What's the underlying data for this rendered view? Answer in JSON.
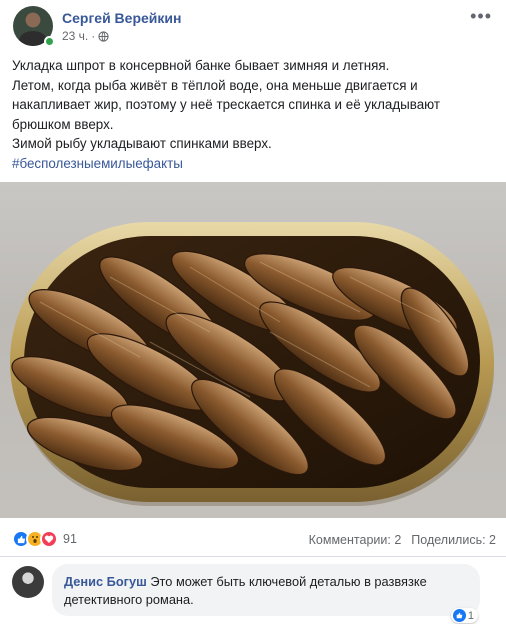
{
  "post": {
    "author": "Сергей Верейкин",
    "time": "23 ч.",
    "audience_icon": "globe-icon",
    "more_icon": "more-options-icon",
    "lines": [
      "Укладка шпрот в консервной банке бывает зимняя и летняя.",
      "Летом, когда рыба живёт в тёплой воде, она меньше двигается и",
      "накапливает жир, поэтому у неё трескается спинка и её укладывают",
      "брюшком вверх.",
      "Зимой рыбу укладывают спинками вверх."
    ],
    "hashtag": "#бесполезныемилыефакты"
  },
  "reactions": {
    "icons": [
      "like-icon",
      "wow-icon",
      "love-icon"
    ],
    "count": "91",
    "comments_label": "Комментарии: 2",
    "shares_label": "Поделились: 2"
  },
  "comment": {
    "author": "Денис Богуш",
    "text": "Это может быть ключевой деталью в развязке детективного романа.",
    "likes": "1"
  },
  "colors": {
    "link": "#385898",
    "like": "#1877f2",
    "love": "#f33e58",
    "wow": "#f7b125",
    "online": "#31a24c"
  }
}
